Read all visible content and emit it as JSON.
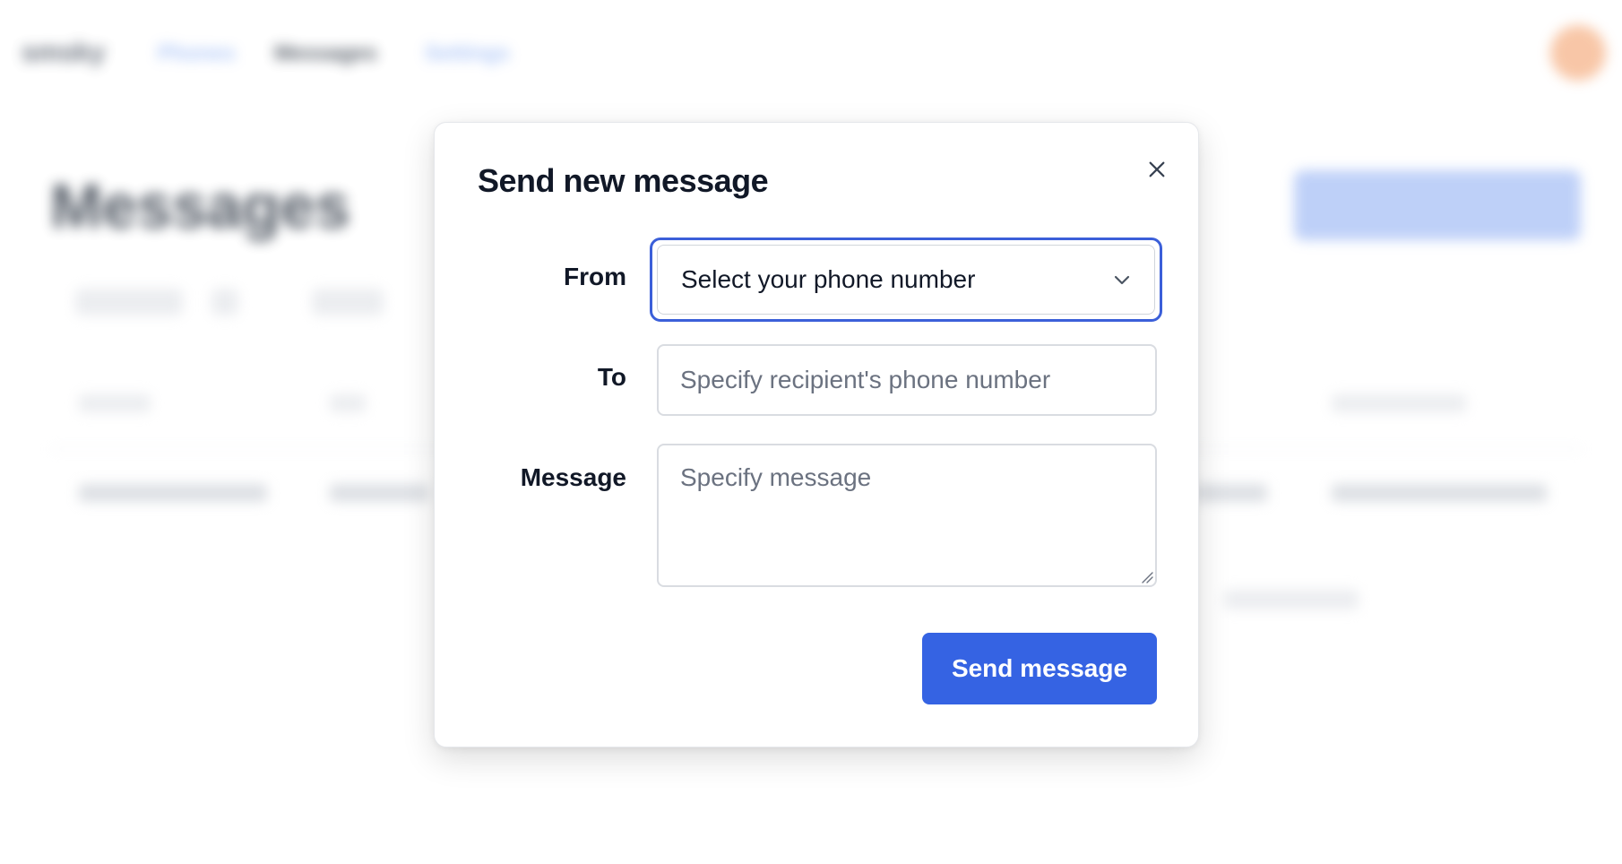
{
  "background": {
    "brand": "smsky",
    "nav": [
      "Phones",
      "Messages",
      "Settings"
    ],
    "page_title": "Messages"
  },
  "modal": {
    "title": "Send new message",
    "close_icon": "close-icon",
    "from": {
      "label": "From",
      "value": "Select your phone number",
      "icon": "chevron-down-icon"
    },
    "to": {
      "label": "To",
      "placeholder": "Specify recipient's phone number"
    },
    "message": {
      "label": "Message",
      "placeholder": "Specify message"
    },
    "submit_label": "Send message"
  },
  "colors": {
    "accent": "#3563e3",
    "focus_ring": "#3b5fd9",
    "placeholder": "#6b7280"
  }
}
